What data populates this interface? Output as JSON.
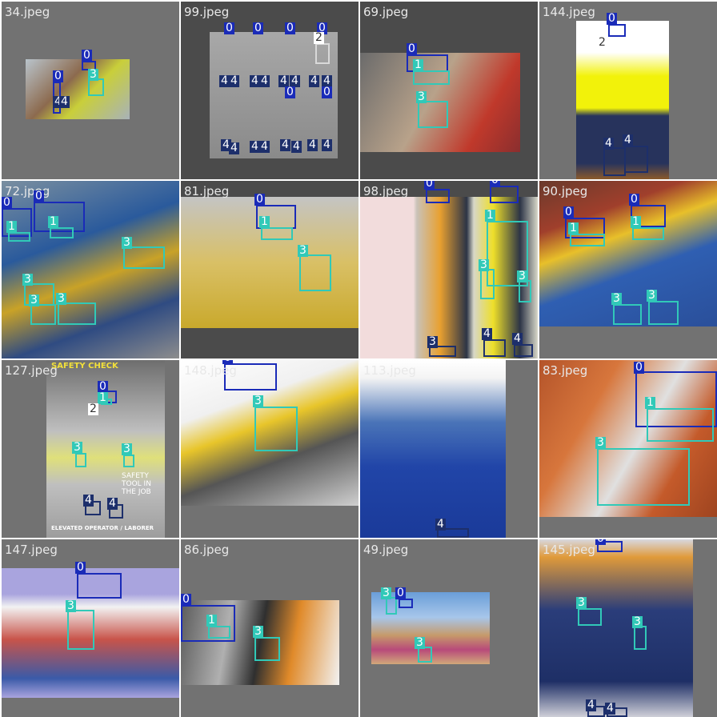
{
  "tiles": [
    {
      "name": "34.jpeg",
      "labels": [
        "0",
        "0",
        "3",
        "4",
        "4"
      ]
    },
    {
      "name": "99.jpeg",
      "labels": [
        "0",
        "0",
        "0",
        "0",
        "2",
        "4",
        "4",
        "4",
        "4",
        "4",
        "4",
        "4",
        "4",
        "0",
        "0",
        "4",
        "4",
        "4",
        "4",
        "4",
        "4",
        "4",
        "4"
      ]
    },
    {
      "name": "69.jpeg",
      "labels": [
        "0",
        "1",
        "3"
      ]
    },
    {
      "name": "144.jpeg",
      "labels": [
        "0",
        "2",
        "4",
        "4"
      ]
    },
    {
      "name": "72.jpeg",
      "labels": [
        "0",
        "0",
        "1",
        "1",
        "3",
        "3",
        "3",
        "3"
      ]
    },
    {
      "name": "81.jpeg",
      "labels": [
        "0",
        "1",
        "3"
      ]
    },
    {
      "name": "98.jpeg",
      "labels": [
        "0",
        "0",
        "1",
        "3",
        "3",
        "3",
        "4",
        "4",
        "4"
      ]
    },
    {
      "name": "90.jpeg",
      "labels": [
        "0",
        "0",
        "1",
        "1",
        "3",
        "3"
      ]
    },
    {
      "name": "127.jpeg",
      "labels": [
        "0",
        "1",
        "2",
        "3",
        "3",
        "4",
        "4"
      ],
      "poster": "SAFETY CHECK",
      "poster2": "SAFETY TOOL IN THE JOB",
      "poster3": "ELEVATED OPERATOR / LABORER"
    },
    {
      "name": "148.jpeg",
      "labels": [
        "0",
        "3"
      ]
    },
    {
      "name": "113.jpeg",
      "labels": [
        "4"
      ]
    },
    {
      "name": "83.jpeg",
      "labels": [
        "0",
        "1",
        "3"
      ]
    },
    {
      "name": "147.jpeg",
      "labels": [
        "0",
        "3"
      ]
    },
    {
      "name": "86.jpeg",
      "labels": [
        "0",
        "1",
        "3"
      ]
    },
    {
      "name": "49.jpeg",
      "labels": [
        "0",
        "3",
        "3"
      ]
    },
    {
      "name": "145.jpeg",
      "labels": [
        "0",
        "3",
        "3",
        "4",
        "4"
      ]
    }
  ],
  "colors": {
    "class0": "#1a2bb8",
    "class1": "#31c9b8",
    "class3": "#31c9b8",
    "class4": "#1d2f6b",
    "tile_bg": "#727272"
  }
}
